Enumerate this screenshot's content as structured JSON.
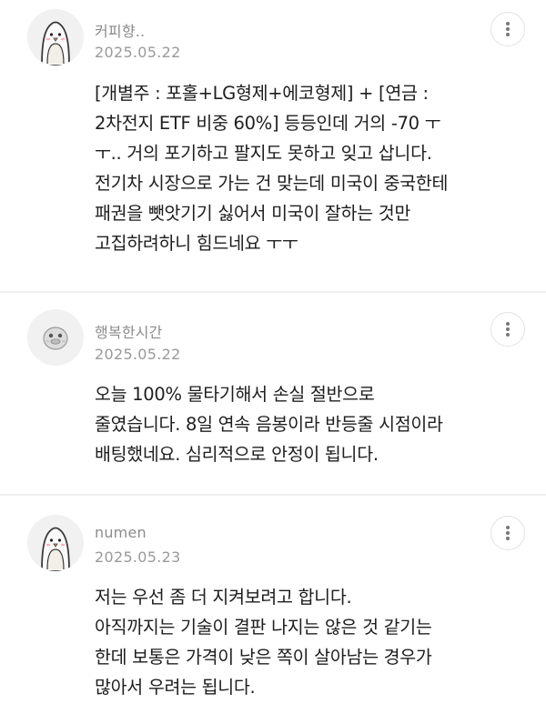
{
  "comments": [
    {
      "username": "커피향..",
      "date": "2025.05.22",
      "avatar_icon": "penguin-avatar-icon",
      "lines": [
        "[개별주 : 포홀+LG형제+에코형제] + [연금 :",
        "2차전지 ETF 비중 60%] 등등인데 거의 -70 ㅜ",
        "ㅜ.. 거의 포기하고 팔지도 못하고 잊고 삽니다.",
        "전기차 시장으로 가는 건 맞는데 미국이 중국한테",
        "패권을 뺏앗기기 싫어서 미국이 잘하는 것만",
        "고집하려하니 힘드네요 ㅜㅜ"
      ]
    },
    {
      "username": "행복한시간",
      "date": "2025.05.22",
      "avatar_icon": "duck-avatar-icon",
      "lines": [
        "오늘 100% 물타기해서 손실 절반으로",
        "줄였습니다. 8일 연속 음봉이라 반등줄 시점이라",
        "배팅했네요. 심리적으로 안정이 됩니다."
      ]
    },
    {
      "username": "numen",
      "date": "2025.05.23",
      "avatar_icon": "penguin-avatar-icon",
      "lines": [
        "저는 우선 좀 더 지켜보려고 합니다.",
        "아직까지는 기술이 결판 나지는 않은 것 같기는",
        "한데 보통은 가격이 낮은 쪽이 살아남는 경우가",
        "많아서 우려는 됩니다."
      ]
    }
  ],
  "more_icon": "more-vertical-icon"
}
